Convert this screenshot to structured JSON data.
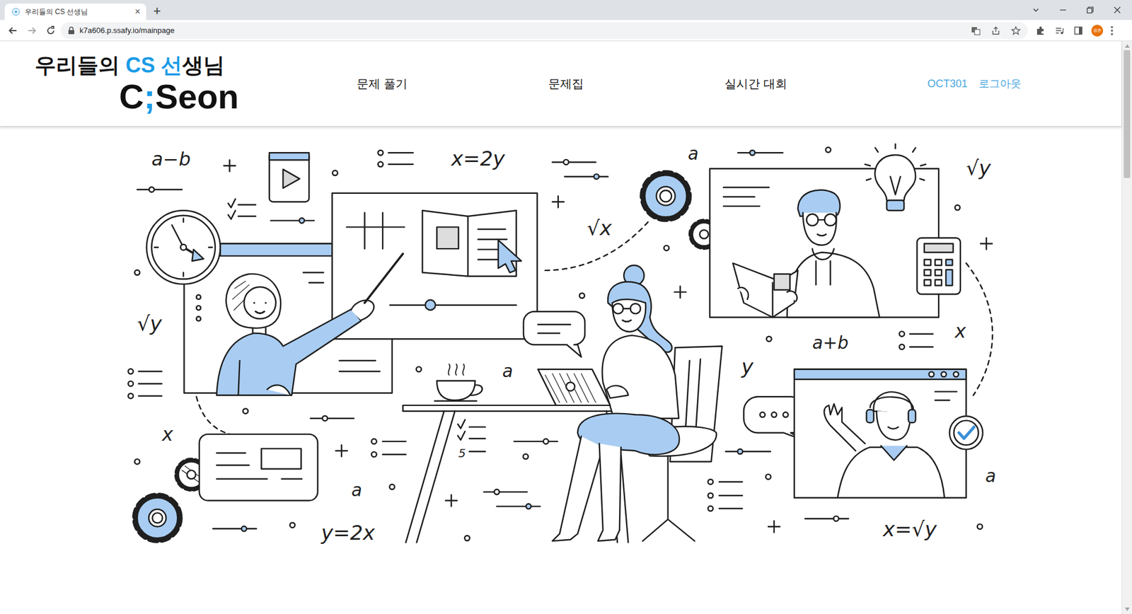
{
  "browser": {
    "tab": {
      "title": "우리들의 CS 선생님",
      "close": "×",
      "selected": true
    },
    "new_tab": "+",
    "url": "k7a606.p.ssafy.io/mainpage",
    "profile": "경준"
  },
  "header": {
    "logo": {
      "line1": [
        {
          "text": "우리들의 ",
          "accent": false
        },
        {
          "text": "CS",
          "accent": true
        },
        {
          "text": " ",
          "accent": false
        },
        {
          "text": "선",
          "accent": true
        },
        {
          "text": "생님",
          "accent": false
        }
      ],
      "line2": [
        {
          "text": "C",
          "accent": false
        },
        {
          "text": ";",
          "accent": true
        },
        {
          "text": "Seon",
          "accent": false
        }
      ]
    },
    "nav": [
      {
        "label": "문제 풀기"
      },
      {
        "label": "문제집"
      },
      {
        "label": "실시간 대회"
      }
    ],
    "user": "OCT301",
    "logout": "로그아웃"
  },
  "illustration": {
    "labels": [
      "a−b",
      "x=2y",
      "a",
      "√y",
      "√x",
      "√y",
      "a",
      "y",
      "a+b",
      "x",
      "x",
      "a",
      "a",
      "y=2x",
      "x=√y",
      "5"
    ]
  },
  "scrollbar": {
    "level": 0.23
  }
}
